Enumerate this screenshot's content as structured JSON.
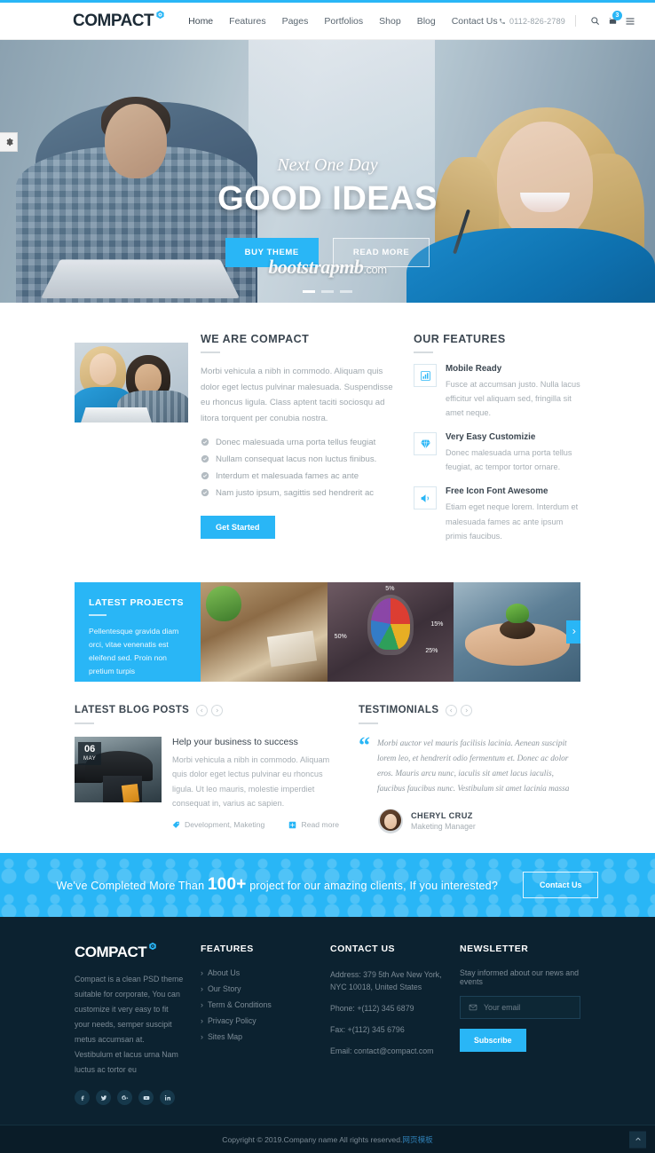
{
  "header": {
    "logo": "COMPACT",
    "logo_icon": "hexagon-target-icon",
    "nav": [
      {
        "label": "Home"
      },
      {
        "label": "Features"
      },
      {
        "label": "Pages"
      },
      {
        "label": "Portfolios"
      },
      {
        "label": "Shop"
      },
      {
        "label": "Blog"
      },
      {
        "label": "Contact Us"
      }
    ],
    "phone": "0112-826-2789",
    "cart_count": "3"
  },
  "hero": {
    "subtitle": "Next One Day",
    "title": "GOOD IDEAS",
    "btn_buy": "BUY THEME",
    "btn_read": "READ MORE",
    "watermark": "bootstrapmb",
    "watermark_tld": ".com"
  },
  "about": {
    "title": "WE ARE COMPACT",
    "paragraph": "Morbi vehicula a nibh in commodo. Aliquam quis dolor eget lectus pulvinar malesuada. Suspendisse eu rhoncus ligula. Class aptent taciti sociosqu ad litora torquent per conubia nostra.",
    "list": [
      "Donec malesuada urna porta tellus feugiat",
      "Nullam consequat lacus non luctus finibus.",
      "Interdum et malesuada fames ac ante",
      "Nam justo ipsum, sagittis sed hendrerit ac"
    ],
    "button": "Get Started"
  },
  "features": {
    "title": "OUR FEATURES",
    "items": [
      {
        "icon": "bar-chart-icon",
        "heading": "Mobile Ready",
        "text": "Fusce at accumsan justo. Nulla lacus efficitur vel aliquam sed, fringilla sit amet neque."
      },
      {
        "icon": "diamond-icon",
        "heading": "Very Easy Customizie",
        "text": "Donec malesuada urna porta tellus feugiat, ac tempor tortor ornare."
      },
      {
        "icon": "megaphone-icon",
        "heading": "Free Icon Font Awesome",
        "text": "Etiam eget neque lorem. Interdum et malesuada fames ac ante ipsum primis faucibus."
      }
    ]
  },
  "projects": {
    "title": "LATEST PROJECTS",
    "text": "Pellentesque gravida diam orci, vitae venenatis est eleifend sed. Proin non pretium turpis",
    "chart_labels": [
      "5%",
      "15%",
      "25%",
      "50%"
    ]
  },
  "blog": {
    "title": "LATEST BLOG POSTS",
    "post": {
      "day": "06",
      "month": "MAY",
      "title": "Help your business to success",
      "excerpt": "Morbi vehicula a nibh in commodo. Aliquam quis dolor eget lectus pulvinar eu rhoncus ligula. Ut leo mauris, molestie imperdiet consequat in, varius ac sapien.",
      "tags": "Development, Maketing",
      "read_more": "Read more"
    }
  },
  "testimonials": {
    "title": "TESTIMONIALS",
    "quote": "Morbi auctor vel mauris facilisis lacinia. Aenean suscipit lorem leo, et hendrerit odio fermentum et. Donec ac dolor eros. Mauris arcu nunc, iaculis sit amet lacus iaculis, faucibus faucibus nunc. Vestibulum sit amet lacinia massa",
    "author_name": "CHERYL CRUZ",
    "author_role": "Maketing Manager"
  },
  "cta": {
    "text_before": "We've Completed More Than ",
    "count": "100+",
    "text_after": " project for our amazing clients, If you interested?",
    "button": "Contact Us"
  },
  "footer": {
    "logo": "COMPACT",
    "about": "Compact is a clean PSD theme suitable for corporate, You can customize it very easy to fit your needs, semper suscipit metus accumsan at. Vestibulum et lacus urna Nam luctus ac tortor eu",
    "socials": [
      "facebook-icon",
      "twitter-icon",
      "google-plus-icon",
      "youtube-icon",
      "linkedin-icon"
    ],
    "features_title": "FEATURES",
    "features_links": [
      "About Us",
      "Our Story",
      "Term & Conditions",
      "Privacy Policy",
      "Sites Map"
    ],
    "contact_title": "CONTACT US",
    "contact_address": "Address: 379 5th Ave New York, NYC 10018, United States",
    "contact_phone": "Phone: +(112) 345 6879",
    "contact_fax": "Fax: +(112) 345 6796",
    "contact_email": "Email: contact@compact.com",
    "newsletter_title": "NEWSLETTER",
    "newsletter_text": "Stay informed about our news and events",
    "newsletter_placeholder": "Your email",
    "newsletter_value": "",
    "subscribe": "Subscribe"
  },
  "copyright": {
    "text": "Copyright © 2019.Company name All rights reserved.",
    "link": "网页模板"
  },
  "colors": {
    "accent": "#29b6f6",
    "footer_bg": "#0c2230",
    "copybar_bg": "#0a1c28",
    "heading": "#3b4650"
  }
}
